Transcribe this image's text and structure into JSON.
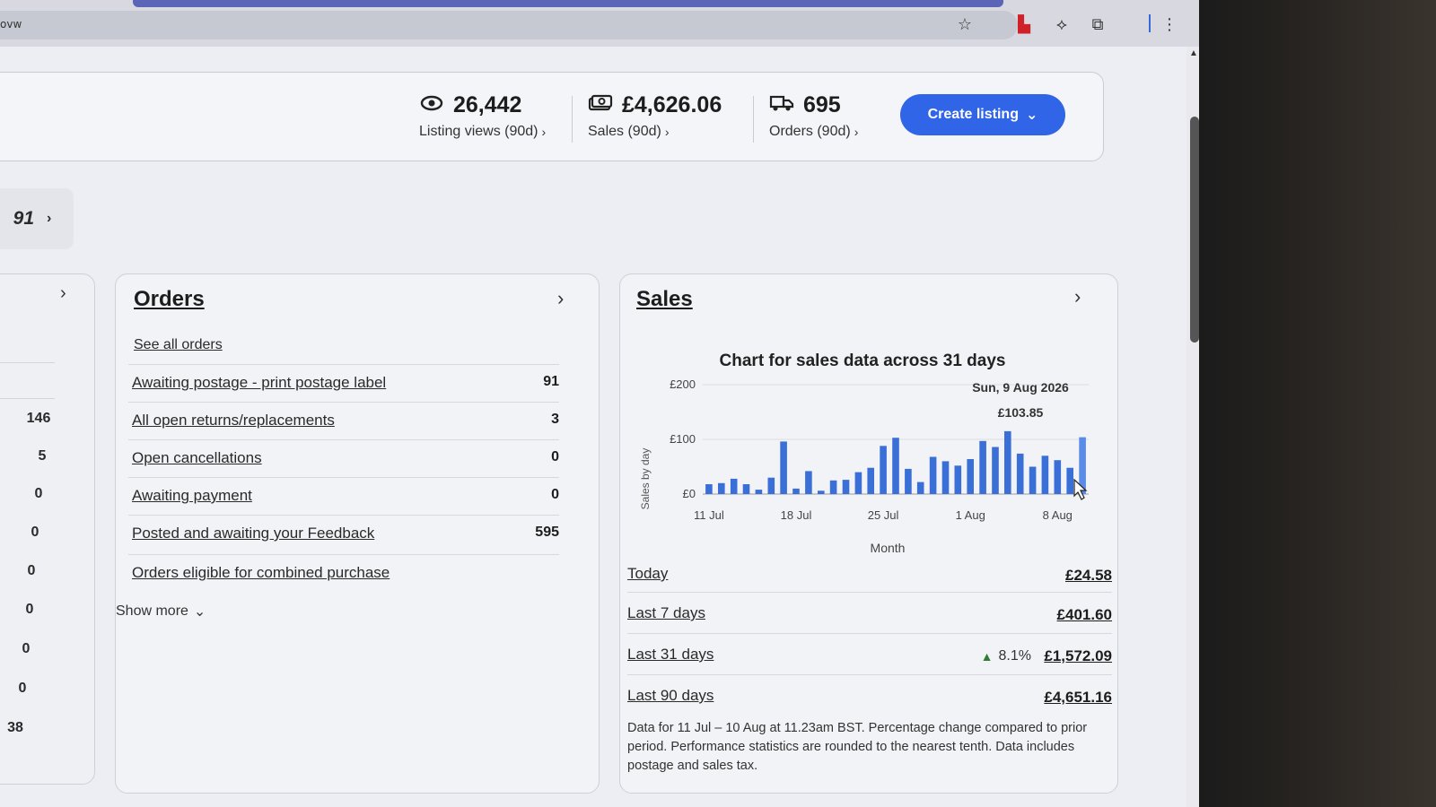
{
  "browser": {
    "address_fragment": "ovw",
    "icons": [
      "star-icon",
      "bookmark-icon",
      "extension-icon",
      "puzzle-icon",
      "menu-dots-icon"
    ]
  },
  "summary": {
    "listing_views": {
      "value": "26,442",
      "label": "Listing views (90d)",
      "icon": "eye-icon"
    },
    "sales": {
      "value": "£4,626.06",
      "label": "Sales (90d)",
      "icon": "money-icon"
    },
    "orders": {
      "value": "695",
      "label": "Orders (90d)",
      "icon": "truck-icon"
    },
    "create_listing_label": "Create listing"
  },
  "pill": {
    "value": "91"
  },
  "left_card": {
    "values": [
      "146",
      "5",
      "0",
      "0",
      "0",
      "0",
      "0",
      "0",
      "38"
    ]
  },
  "orders_card": {
    "title": "Orders",
    "see_all": "See all orders",
    "rows": [
      {
        "label": "Awaiting postage - print postage label",
        "value": "91"
      },
      {
        "label": "All open returns/replacements",
        "value": "3"
      },
      {
        "label": "Open cancellations",
        "value": "0"
      },
      {
        "label": "Awaiting payment",
        "value": "0"
      },
      {
        "label": "Posted and awaiting your Feedback",
        "value": "595"
      },
      {
        "label": "Orders eligible for combined purchase",
        "value": ""
      }
    ],
    "show_more": "Show more"
  },
  "sales_card": {
    "title": "Sales",
    "rows": [
      {
        "label": "Today",
        "value": "£24.58",
        "change": ""
      },
      {
        "label": "Last 7 days",
        "value": "£401.60",
        "change": ""
      },
      {
        "label": "Last 31 days",
        "value": "£1,572.09",
        "change": "8.1%"
      },
      {
        "label": "Last 90 days",
        "value": "£4,651.16",
        "change": ""
      }
    ],
    "footnote": "Data for 11 Jul – 10 Aug at 11.23am BST. Percentage change compared to prior period. Performance statistics are rounded to the nearest tenth. Data includes postage and sales tax."
  },
  "chart_data": {
    "type": "bar",
    "title": "Chart for sales data across 31 days",
    "xlabel": "Month",
    "ylabel": "Sales by day",
    "ylim": [
      0,
      200
    ],
    "yticks": [
      "£0",
      "£100",
      "£200"
    ],
    "xticks": [
      "11 Jul",
      "18 Jul",
      "25 Jul",
      "1 Aug",
      "8 Aug"
    ],
    "tooltip": {
      "date": "Sun, 9 Aug 2026",
      "value": "£103.85"
    },
    "accent_color": "#3a6fd8",
    "values": [
      18,
      20,
      28,
      18,
      8,
      30,
      96,
      10,
      42,
      6,
      25,
      26,
      40,
      48,
      88,
      103,
      46,
      22,
      68,
      60,
      52,
      64,
      97,
      86,
      115,
      74,
      50,
      70,
      62,
      48,
      104
    ]
  }
}
